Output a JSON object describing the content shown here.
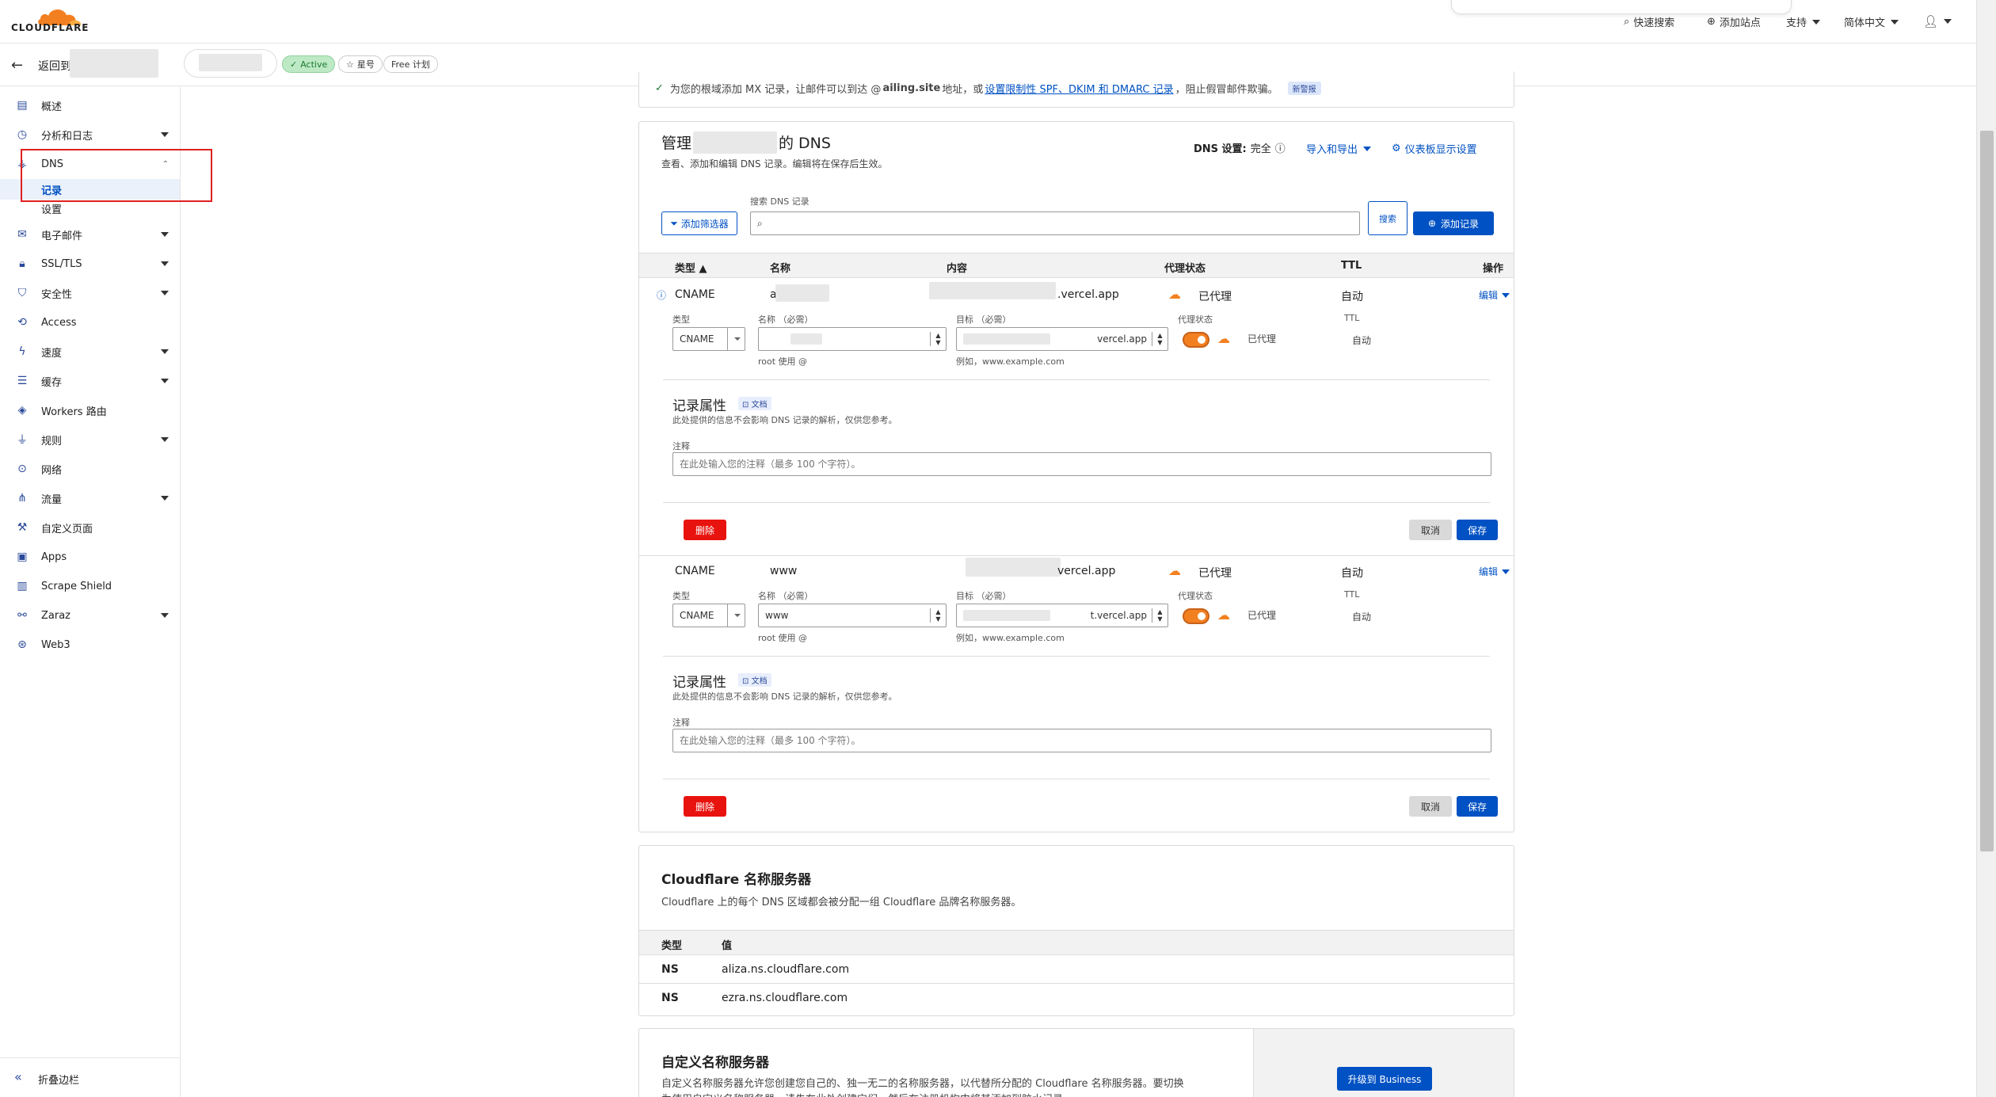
{
  "brand": {
    "name": "CLOUDFLARE",
    "accent": "#f38020",
    "link": "#0051c3"
  },
  "topnav": {
    "quick_search": "快速搜索",
    "add_site": "添加站点",
    "support": "支持",
    "language": "简体中文"
  },
  "zone": {
    "back_label": "返回到",
    "status": "Active",
    "star": "星号",
    "plan": "Free 计划"
  },
  "sidebar": {
    "items": [
      {
        "label": "概述",
        "icon": "clipboard-icon"
      },
      {
        "label": "分析和日志",
        "icon": "chart-icon"
      },
      {
        "label": "DNS",
        "icon": "network-icon"
      },
      {
        "label": "记录",
        "icon": ""
      },
      {
        "label": "设置",
        "icon": ""
      },
      {
        "label": "电子邮件",
        "icon": "email-icon"
      },
      {
        "label": "SSL/TLS",
        "icon": "lock-icon"
      },
      {
        "label": "安全性",
        "icon": "shield-icon"
      },
      {
        "label": "Access",
        "icon": "access-icon"
      },
      {
        "label": "速度",
        "icon": "bolt-icon"
      },
      {
        "label": "缓存",
        "icon": "storage-icon"
      },
      {
        "label": "Workers 路由",
        "icon": "workers-icon"
      },
      {
        "label": "规则",
        "icon": "funnel-icon"
      },
      {
        "label": "网络",
        "icon": "pin-icon"
      },
      {
        "label": "流量",
        "icon": "traffic-icon"
      },
      {
        "label": "自定义页面",
        "icon": "wrench-icon"
      },
      {
        "label": "Apps",
        "icon": "apps-icon"
      },
      {
        "label": "Scrape Shield",
        "icon": "document-icon"
      },
      {
        "label": "Zaraz",
        "icon": "zaraz-icon"
      },
      {
        "label": "Web3",
        "icon": "web3-icon"
      }
    ],
    "collapse": "折叠边栏"
  },
  "mx_notice": {
    "text_a": "为您的根域添加 MX 记录，让邮件可以到达 @",
    "domain": "ailing.site",
    "text_b": " 地址，或",
    "link": "设置限制性 SPF、DKIM 和 DMARC 记录",
    "text_c": "，阻止假冒邮件欺骗。",
    "badge": "新警报"
  },
  "dns": {
    "title_a": "管理",
    "title_b": "的 DNS",
    "subtitle": "查看、添加和编辑 DNS 记录。编辑将在保存后生效。",
    "settings_label": "DNS 设置:",
    "settings_value": "完全",
    "import_export": "导入和导出",
    "dashboard_settings": "仪表板显示设置",
    "filter_button": "添加筛选器",
    "search_label": "搜索 DNS 记录",
    "search_button": "搜索",
    "add_record": "添加记录",
    "columns": {
      "type": "类型",
      "name": "名称",
      "content": "内容",
      "proxy": "代理状态",
      "ttl": "TTL",
      "actions": "操作"
    },
    "records": [
      {
        "type": "CNAME",
        "name": "a",
        "content": ".vercel.app",
        "proxy": "已代理",
        "ttl": "自动",
        "action": "编辑",
        "form": {
          "type_label": "类型",
          "type_value": "CNAME",
          "name_label": "名称 （必需）",
          "name_value": "",
          "name_hint": "root 使用 @",
          "target_label": "目标 （必需）",
          "target_value": "vercel.app",
          "target_hint": "例如，www.example.com",
          "proxy_label": "代理状态",
          "proxy_value": "已代理",
          "ttl_label": "TTL",
          "ttl_value": "自动"
        }
      },
      {
        "type": "CNAME",
        "name": "www",
        "content": "vercel.app",
        "proxy": "已代理",
        "ttl": "自动",
        "action": "编辑",
        "form": {
          "type_label": "类型",
          "type_value": "CNAME",
          "name_label": "名称 （必需）",
          "name_value": "www",
          "name_hint": "root 使用 @",
          "target_label": "目标 （必需）",
          "target_value": "t.vercel.app",
          "target_hint": "例如，www.example.com",
          "proxy_label": "代理状态",
          "proxy_value": "已代理",
          "ttl_label": "TTL",
          "ttl_value": "自动"
        }
      }
    ],
    "attrs": {
      "title": "记录属性",
      "docs": "文档",
      "desc": "此处提供的信息不会影响 DNS 记录的解析，仅供您参考。",
      "comment_label": "注释",
      "comment_placeholder": "在此处输入您的注释（最多 100 个字符）。",
      "delete": "删除",
      "cancel": "取消",
      "save": "保存"
    }
  },
  "nameservers": {
    "title": "Cloudflare 名称服务器",
    "desc": "Cloudflare 上的每个 DNS 区域都会被分配一组 Cloudflare 品牌名称服务器。",
    "col_type": "类型",
    "col_value": "值",
    "rows": [
      {
        "type": "NS",
        "value": "aliza.ns.cloudflare.com"
      },
      {
        "type": "NS",
        "value": "ezra.ns.cloudflare.com"
      }
    ]
  },
  "custom_ns": {
    "title": "自定义名称服务器",
    "desc": "自定义名称服务器允许您创建您自己的、独一无二的名称服务器，以代替所分配的 Cloudflare 名称服务器。要切换",
    "desc2": "为使用自定义名称服务器，请先在此处创建它们，然后在注册机构中将其添加到胶水记录。",
    "upgrade": "升级到 Business"
  }
}
